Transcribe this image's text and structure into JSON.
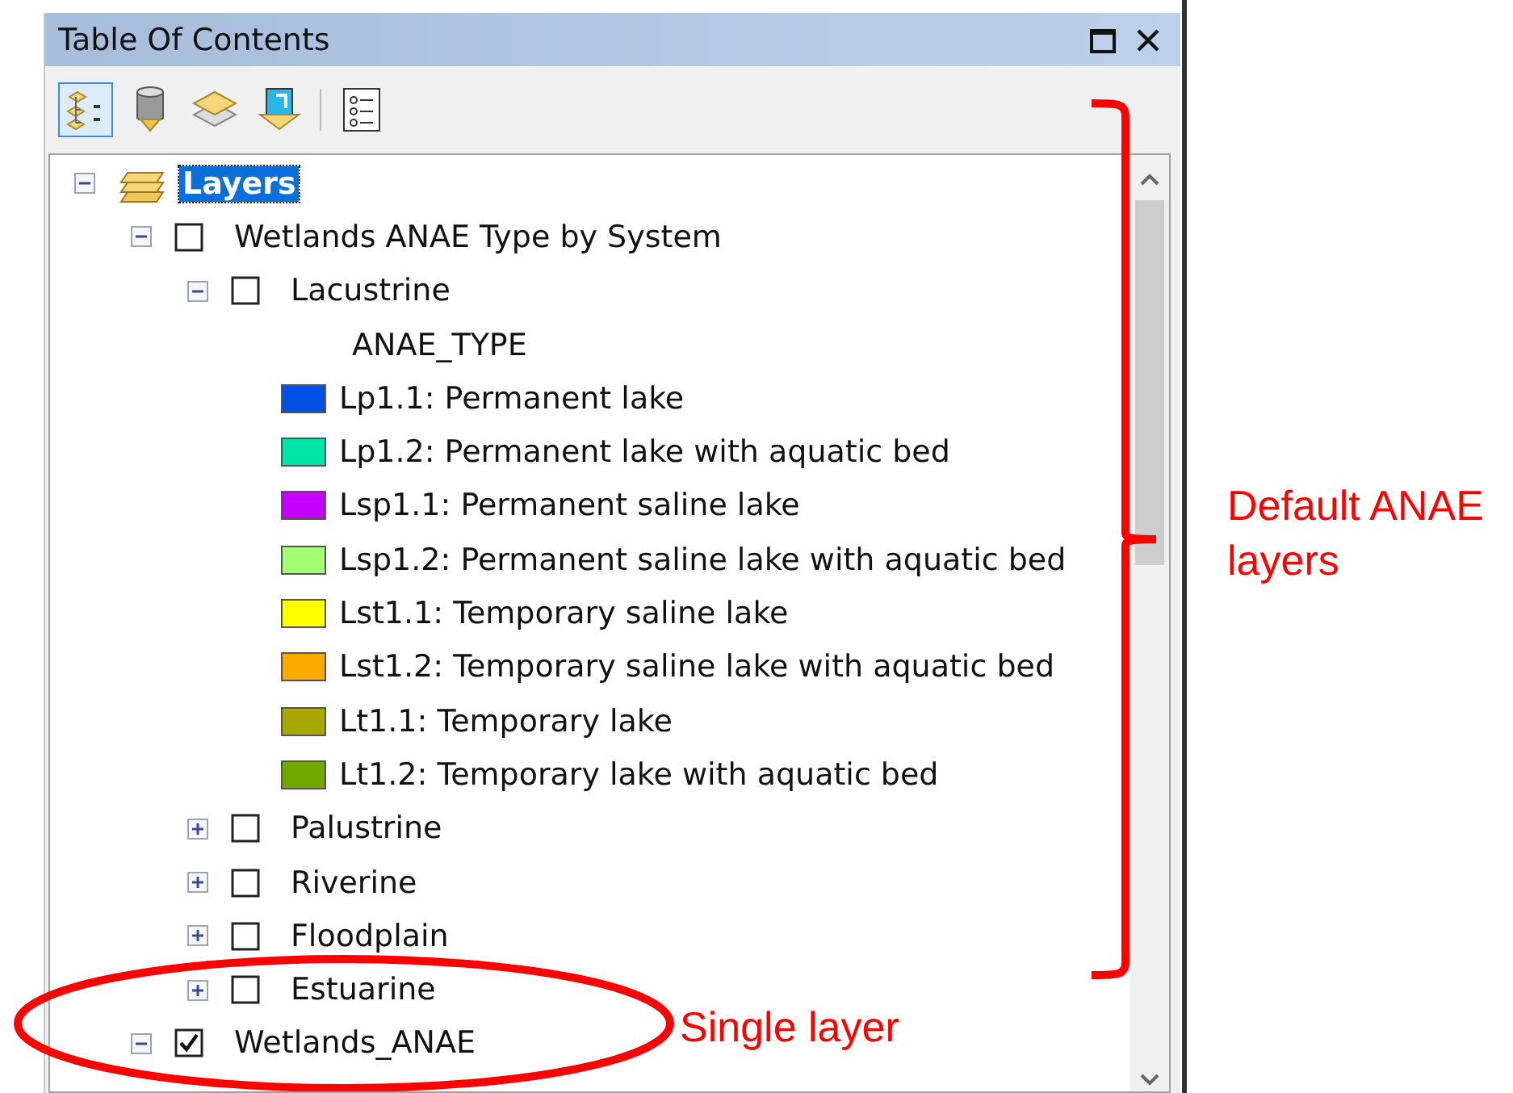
{
  "panel": {
    "title": "Table Of Contents"
  },
  "toolbar": [
    {
      "kind": "drawing-order",
      "selected": true
    },
    {
      "kind": "source",
      "selected": false
    },
    {
      "kind": "visibility",
      "selected": false
    },
    {
      "kind": "selection",
      "selected": false
    },
    {
      "kind": "options",
      "selected": false
    }
  ],
  "tree": [
    {
      "kind": "frame",
      "label": "Layers",
      "expanded": true,
      "selected": true,
      "children": [
        {
          "kind": "layer",
          "label": "Wetlands ANAE Type by System",
          "expanded": true,
          "checked": false,
          "selected": false,
          "children": [
            {
              "kind": "layer",
              "label": "Lacustrine",
              "expanded": true,
              "checked": false,
              "selected": false,
              "children": [
                {
                  "kind": "heading",
                  "label": "ANAE_TYPE"
                },
                {
                  "kind": "legend",
                  "label": "Lp1.1: Permanent lake",
                  "color": "#0050e6"
                },
                {
                  "kind": "legend",
                  "label": "Lp1.2: Permanent lake with aquatic bed",
                  "color": "#00e6a9"
                },
                {
                  "kind": "legend",
                  "label": "Lsp1.1: Permanent saline lake",
                  "color": "#c500ff"
                },
                {
                  "kind": "legend",
                  "label": "Lsp1.2: Permanent saline lake with aquatic bed",
                  "color": "#a3ff73"
                },
                {
                  "kind": "legend",
                  "label": "Lst1.1: Temporary saline lake",
                  "color": "#ffff00"
                },
                {
                  "kind": "legend",
                  "label": "Lst1.2: Temporary saline lake with aquatic bed",
                  "color": "#ffaa00"
                },
                {
                  "kind": "legend",
                  "label": "Lt1.1: Temporary lake",
                  "color": "#a8a800"
                },
                {
                  "kind": "legend",
                  "label": "Lt1.2: Temporary lake with aquatic bed",
                  "color": "#70a800"
                }
              ]
            },
            {
              "kind": "layer",
              "label": "Palustrine",
              "expanded": false,
              "checked": false,
              "selected": false
            },
            {
              "kind": "layer",
              "label": "Riverine",
              "expanded": false,
              "checked": false,
              "selected": false
            },
            {
              "kind": "layer",
              "label": "Floodplain",
              "expanded": false,
              "checked": false,
              "selected": false
            },
            {
              "kind": "layer",
              "label": "Estuarine",
              "expanded": false,
              "checked": false,
              "selected": false
            }
          ]
        },
        {
          "kind": "layer",
          "label": "Wetlands_ANAE",
          "expanded": true,
          "checked": true,
          "selected": false
        }
      ]
    }
  ],
  "annotations": [
    {
      "kind": "bracket",
      "text": "Default ANAE layers"
    },
    {
      "kind": "ellipse",
      "text": "Single layer"
    }
  ]
}
